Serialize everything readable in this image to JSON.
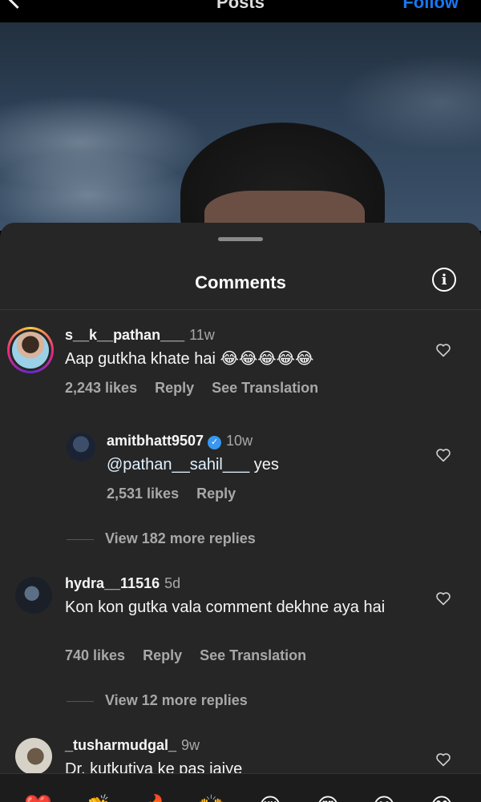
{
  "topbar": {
    "title": "Posts",
    "follow_label": "Follow"
  },
  "sheet": {
    "title": "Comments"
  },
  "comments": [
    {
      "username": "s__k__pathan___",
      "time": "11w",
      "text": "Aap gutkha khate hai 😂😂😂😂😂",
      "likes": "2,243 likes",
      "reply_label": "Reply",
      "translation_label": "See Translation"
    },
    {
      "username": "amitbhatt9507",
      "verified": true,
      "time": "10w",
      "mention": "@pathan__sahil___",
      "text": " yes",
      "likes": "2,531 likes",
      "reply_label": "Reply"
    },
    {
      "username": "hydra__11516",
      "time": "5d",
      "text": "Kon kon gutka vala comment dekhne aya hai",
      "likes": "740 likes",
      "reply_label": "Reply",
      "translation_label": "See Translation"
    },
    {
      "username": "_tusharmudgal_",
      "time": "9w",
      "text": "Dr. kutkutiya ke pas jaiye"
    }
  ],
  "view_more": [
    "View 182 more replies",
    "View 12 more replies"
  ],
  "icons": {
    "info": "info-icon",
    "heart": "heart-outline-icon",
    "verified": "verified-badge-icon"
  },
  "colors": {
    "sheet_bg": "#262626",
    "accent": "#1877f2",
    "verified": "#3897f0",
    "muted": "#a8a8a8"
  }
}
